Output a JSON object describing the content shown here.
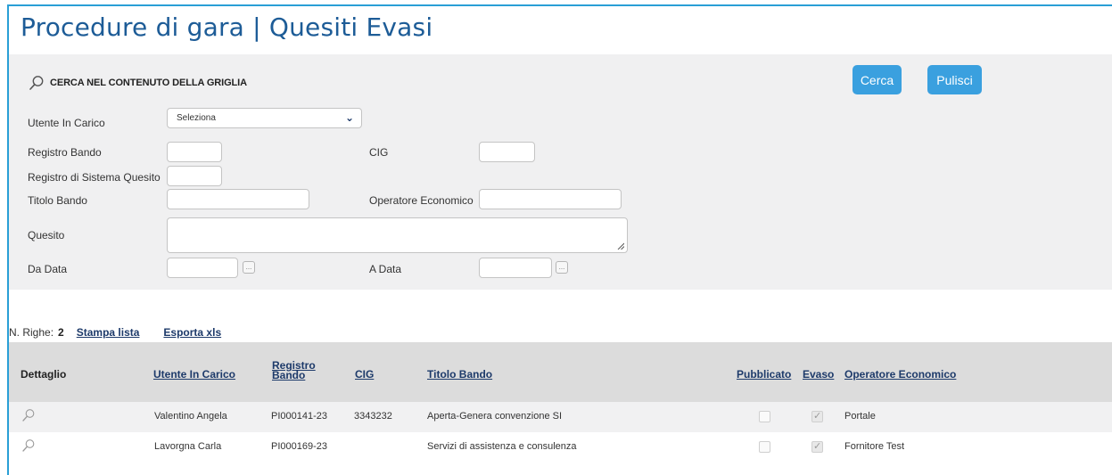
{
  "page_title": "Procedure di gara | Quesiti Evasi",
  "search_panel": {
    "header_label": "CERCA NEL CONTENUTO DELLA GRIGLIA",
    "search_button": "Cerca",
    "clear_button": "Pulisci"
  },
  "filters": {
    "utente_in_carico": {
      "label": "Utente In Carico",
      "selected": "Seleziona"
    },
    "registro_bando": {
      "label": "Registro Bando",
      "value": ""
    },
    "cig": {
      "label": "CIG",
      "value": ""
    },
    "registro_sistema_quesito": {
      "label": "Registro di Sistema Quesito",
      "value": ""
    },
    "titolo_bando": {
      "label": "Titolo Bando",
      "value": ""
    },
    "operatore_economico": {
      "label": "Operatore Economico",
      "value": ""
    },
    "quesito": {
      "label": "Quesito",
      "value": ""
    },
    "da_data": {
      "label": "Da Data",
      "value": "",
      "picker": "..."
    },
    "a_data": {
      "label": "A Data",
      "value": "",
      "picker": "..."
    }
  },
  "list_bar": {
    "rows_label": "N. Righe:",
    "rows_count": "2",
    "print_link": "Stampa lista",
    "export_link": "Esporta xls"
  },
  "grid": {
    "columns": {
      "dettaglio": "Dettaglio",
      "utente_in_carico": "Utente In Carico",
      "registro_bando_1": "Registro",
      "registro_bando_2": "Bando",
      "cig": "CIG",
      "titolo_bando": "Titolo Bando",
      "pubblicato": "Pubblicato",
      "evaso": "Evaso",
      "operatore_economico": "Operatore Economico"
    },
    "rows": [
      {
        "utente": "Valentino Angela",
        "registro": "PI000141-23",
        "cig": "3343232",
        "titolo": "Aperta-Genera convenzione SI",
        "pubblicato": false,
        "evaso": true,
        "operatore": "Portale"
      },
      {
        "utente": "Lavorgna Carla",
        "registro": "PI000169-23",
        "cig": "",
        "titolo": "Servizi di assistenza e consulenza",
        "pubblicato": false,
        "evaso": true,
        "operatore": "Fornitore Test"
      }
    ]
  },
  "colors": {
    "title": "#1d5c97",
    "accent": "#3aa0df",
    "frame_border": "#2a9fd6",
    "link": "#1d3a6a"
  }
}
